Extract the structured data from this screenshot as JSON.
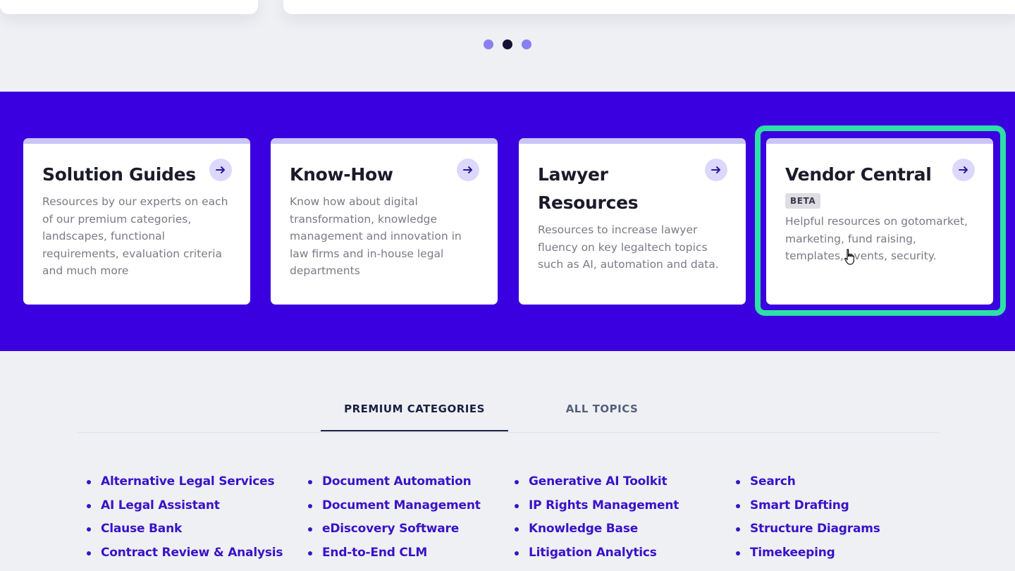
{
  "carousel": {
    "dot_count": 3,
    "active_index": 1
  },
  "resource_cards": [
    {
      "title": "Solution Guides",
      "description": "Resources by our experts on each of our premium categories, landscapes, functional requirements, evaluation criteria and much more"
    },
    {
      "title": "Know-How",
      "description": "Know how about digital transformation, knowledge management and innovation in law firms and in-house legal departments"
    },
    {
      "title": "Lawyer Resources",
      "description": "Resources to increase lawyer fluency on key legaltech topics such as AI, automation and data."
    },
    {
      "title": "Vendor Central",
      "badge": "BETA",
      "description": "Helpful resources on gotomarket, marketing, fund raising, templates, events, security."
    }
  ],
  "tabs": [
    {
      "label": "PREMIUM CATEGORIES",
      "active": true
    },
    {
      "label": "ALL TOPICS",
      "active": false
    }
  ],
  "categories": [
    [
      "Alternative Legal Services",
      "AI Legal Assistant",
      "Clause Bank",
      "Contract Review & Analysis"
    ],
    [
      "Document Automation",
      "Document Management",
      "eDiscovery Software",
      "End-to-End CLM"
    ],
    [
      "Generative AI Toolkit",
      "IP Rights Management",
      "Knowledge Base",
      "Litigation Analytics"
    ],
    [
      "Search",
      "Smart Drafting",
      "Structure Diagrams",
      "Timekeeping"
    ]
  ],
  "colors": {
    "band": "#3a00e0",
    "highlight": "#2ee0a6",
    "link": "#3a12c8",
    "dot_active": "#131235",
    "dot_inactive": "#8a7ff0"
  },
  "icons": {
    "card_arrow": "arrow-right-icon",
    "cursor": "hand-pointer-icon"
  }
}
